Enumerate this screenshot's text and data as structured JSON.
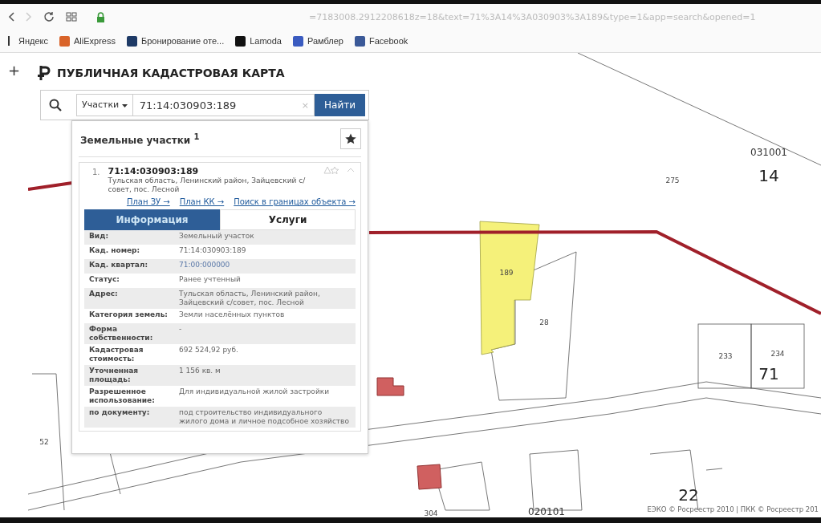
{
  "browser": {
    "url": "=7183008.2912208618z=18&text=71%3A14%3A030903%3A189&type=1&app=search&opened=1",
    "forward_disabled": true
  },
  "bookmarks": [
    {
      "label": "Яндекс"
    },
    {
      "label": "AliExpress"
    },
    {
      "label": "Бронирование оте..."
    },
    {
      "label": "Lamoda"
    },
    {
      "label": "Рамблер"
    },
    {
      "label": "Facebook"
    }
  ],
  "zoom_control": "+",
  "app": {
    "title": "ПУБЛИЧНАЯ КАДАСТРОВАЯ КАРТА"
  },
  "search": {
    "category": "Участки",
    "value": "71:14:030903:189",
    "clear": "×",
    "button": "Найти"
  },
  "results": {
    "heading": "Земельные участки $^{1}$",
    "item": {
      "index": "1.",
      "number": "71:14:030903:189",
      "address": "Тульская область, Ленинский район, Зайцевский с/совет, пос. Лесной",
      "links": [
        "План ЗУ →",
        "План КК →",
        "Поиск в границах объекта →"
      ],
      "tabs": [
        {
          "label": "Информация",
          "selected": true
        },
        {
          "label": "Услуги",
          "selected": false
        }
      ],
      "rows": [
        {
          "label": "Вид:",
          "value": "Земельный участок",
          "kind": "text"
        },
        {
          "label": "Кад. номер:",
          "value": "71:14:030903:189",
          "kind": "text"
        },
        {
          "label": "Кад. квартал:",
          "value": "71:00:000000",
          "kind": "link"
        },
        {
          "label": "Статус:",
          "value": "Ранее учтенный",
          "kind": "text"
        },
        {
          "label": "Адрес:",
          "value": "Тульская область, Ленинский район, Зайцевский с/совет, пос. Лесной",
          "kind": "text"
        },
        {
          "label": "Категория земель:",
          "value": "Земли населённых пунктов",
          "kind": "text"
        },
        {
          "label": "Форма собственности:",
          "value": "-",
          "kind": "text"
        },
        {
          "label": "Кадастровая стоимость:",
          "value": "692 524,92 руб.",
          "kind": "text"
        },
        {
          "label": "Уточненная площадь:",
          "value": "1 156 кв. м",
          "kind": "text"
        },
        {
          "label": "Разрешенное использование:",
          "value": "Для индивидуальной жилой застройки",
          "kind": "text"
        },
        {
          "label": "по документу:",
          "value": "под строительство индивидуального жилого дома и личное подсобное хозяйство",
          "kind": "text"
        }
      ]
    }
  },
  "map": {
    "labels": [
      {
        "text": "031001",
        "kind": "quarter"
      },
      {
        "text": "275",
        "kind": "parcel"
      },
      {
        "text": "14",
        "kind": "big"
      },
      {
        "text": "189",
        "kind": "parcel"
      },
      {
        "text": "28",
        "kind": "parcel"
      },
      {
        "text": "233",
        "kind": "parcel"
      },
      {
        "text": "234",
        "kind": "parcel"
      },
      {
        "text": "71",
        "kind": "big"
      },
      {
        "text": "52",
        "kind": "parcel"
      },
      {
        "text": "304",
        "kind": "parcel"
      },
      {
        "text": "020101",
        "kind": "quarter"
      },
      {
        "text": "22",
        "kind": "big"
      }
    ],
    "copyright": "ЕЭКО © Росреестр 2010 | ПКК © Росреестр 201"
  }
}
